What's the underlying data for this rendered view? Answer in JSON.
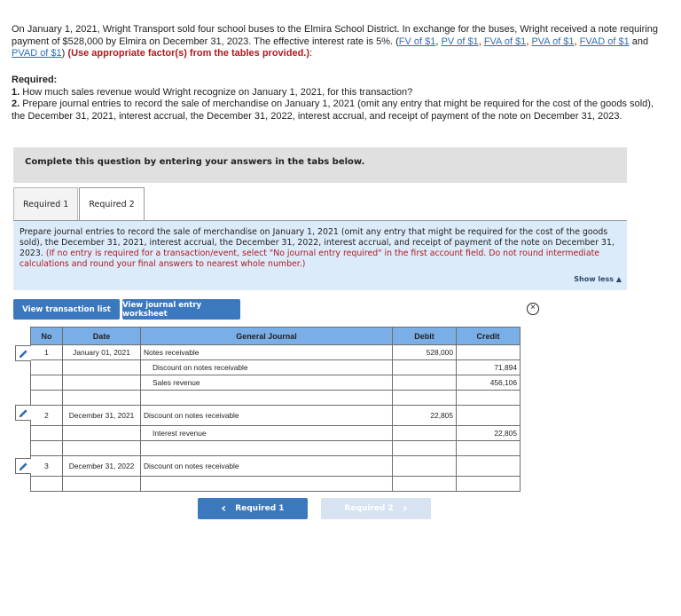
{
  "intro": {
    "text1": "On January 1, 2021, Wright Transport sold four school buses to the Elmira School District. In exchange for the buses, Wright received a note requiring payment of $528,000 by Elmira on December 31, 2023. The effective interest rate is 5%. (",
    "links": [
      "FV of $1",
      "PV of $1",
      "FVA of $1",
      "PVA of $1",
      "FVAD of $1",
      "PVAD of $1"
    ],
    "and": " and ",
    "close_paren": ") ",
    "warning": "(Use appropriate factor(s) from the tables provided.)",
    "colon": ":"
  },
  "required": {
    "header": "Required:",
    "items": [
      {
        "num": "1.",
        "text": " How much sales revenue would Wright recognize on January 1, 2021, for this transaction?"
      },
      {
        "num": "2.",
        "text": " Prepare journal entries to record the sale of merchandise on January 1, 2021 (omit any entry that might be required for the cost of the goods sold), the December 31, 2021, interest accrual, the December 31, 2022, interest accrual, and receipt of payment of the note on December 31, 2023."
      }
    ]
  },
  "complete_bar": "Complete this question by entering your answers in the tabs below.",
  "tabs": [
    {
      "label": "Required 1",
      "active": false
    },
    {
      "label": "Required 2",
      "active": true
    }
  ],
  "instructions": {
    "text": "Prepare journal entries to record the sale of merchandise on January 1, 2021 (omit any entry that might be required for the cost of the goods sold), the December 31, 2021, interest accrual, the December 31, 2022, interest accrual, and receipt of payment of the note on December 31, 2023. ",
    "red": "(If no entry is required for a transaction/event, select \"No journal entry required\" in the first account field. Do not round intermediate calculations and round your final answers to nearest whole number.)",
    "show_less": "Show less ▲"
  },
  "buttons": {
    "transaction_list": "View transaction list",
    "journal_worksheet": "View journal entry worksheet"
  },
  "journal": {
    "headers": {
      "no": "No",
      "date": "Date",
      "account": "General Journal",
      "debit": "Debit",
      "credit": "Credit"
    },
    "rows": [
      {
        "no": "1",
        "date": "January 01, 2021",
        "account": "Notes receivable",
        "indent": false,
        "debit": "528,000",
        "credit": "",
        "tall": false
      },
      {
        "no": "",
        "date": "",
        "account": "Discount on notes receivable",
        "indent": true,
        "debit": "",
        "credit": "71,894",
        "tall": false
      },
      {
        "no": "",
        "date": "",
        "account": "Sales revenue",
        "indent": true,
        "debit": "",
        "credit": "456,106",
        "tall": false
      },
      {
        "no": "",
        "date": "",
        "account": "",
        "indent": false,
        "debit": "",
        "credit": "",
        "tall": false
      },
      {
        "no": "2",
        "date": "December 31, 2021",
        "account": "Discount on notes receivable",
        "indent": false,
        "debit": "22,805",
        "credit": "",
        "tall": true
      },
      {
        "no": "",
        "date": "",
        "account": "Interest revenue",
        "indent": true,
        "debit": "",
        "credit": "22,805",
        "tall": false
      },
      {
        "no": "",
        "date": "",
        "account": "",
        "indent": false,
        "debit": "",
        "credit": "",
        "tall": false
      },
      {
        "no": "3",
        "date": "December 31, 2022",
        "account": "Discount on notes receivable",
        "indent": false,
        "debit": "",
        "credit": "",
        "tall": true
      },
      {
        "no": "",
        "date": "",
        "account": "",
        "indent": false,
        "debit": "",
        "credit": "",
        "tall": false
      }
    ]
  },
  "nav": {
    "prev_label": "Required 1",
    "prev_icon": "‹",
    "next_label": "Required 2",
    "next_icon": "›"
  },
  "colors": {
    "accent": "#3b78bd",
    "header_bg": "#7aaee6",
    "instructions_bg": "#dcebf9",
    "warning": "#b0191e"
  }
}
